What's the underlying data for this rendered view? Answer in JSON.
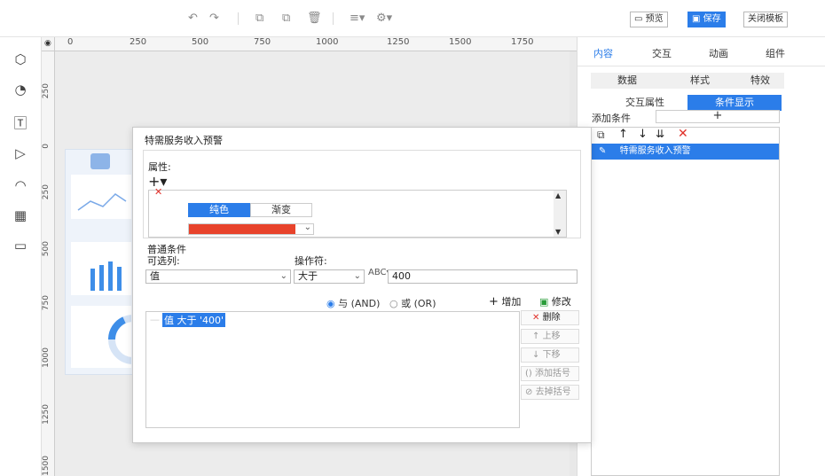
{
  "toolbar": {
    "preview_label": "预览",
    "save_label": "保存",
    "close_panel_label": "关闭模板"
  },
  "ruler": {
    "top_ticks": [
      "0",
      "250",
      "500",
      "750",
      "1000",
      "1250",
      "1500",
      "1750"
    ],
    "left_ticks": [
      "250",
      "0",
      "250",
      "500",
      "750",
      "1000",
      "1250",
      "1500"
    ]
  },
  "right_panel": {
    "tabs": [
      "内容",
      "交互",
      "动画",
      "组件"
    ],
    "sub_tabs": [
      "数据",
      "样式",
      "特效"
    ],
    "mode_tabs": [
      "交互属性",
      "条件显示"
    ],
    "add_condition_label": "添加条件",
    "add_symbol": "+",
    "condition_item": "特需服务收入预警"
  },
  "dialog": {
    "title": "特需服务收入预警",
    "attr_label": "属性:",
    "color_options": [
      "纯色",
      "渐变"
    ],
    "fill_color": "#e8432b",
    "normal_cond_label": "普通条件",
    "optional_col_label": "可选列:",
    "operator_label": "操作符:",
    "column_value": "值",
    "operator_value": "大于",
    "input_value": "400",
    "logic_and": "与 (AND)",
    "logic_or": "或 (OR)",
    "add_label": "增加",
    "modify_label": "修改",
    "expression": "值 大于 '400'",
    "side_buttons": [
      "删除",
      "上移",
      "下移",
      "添加括号",
      "去掉括号"
    ]
  }
}
